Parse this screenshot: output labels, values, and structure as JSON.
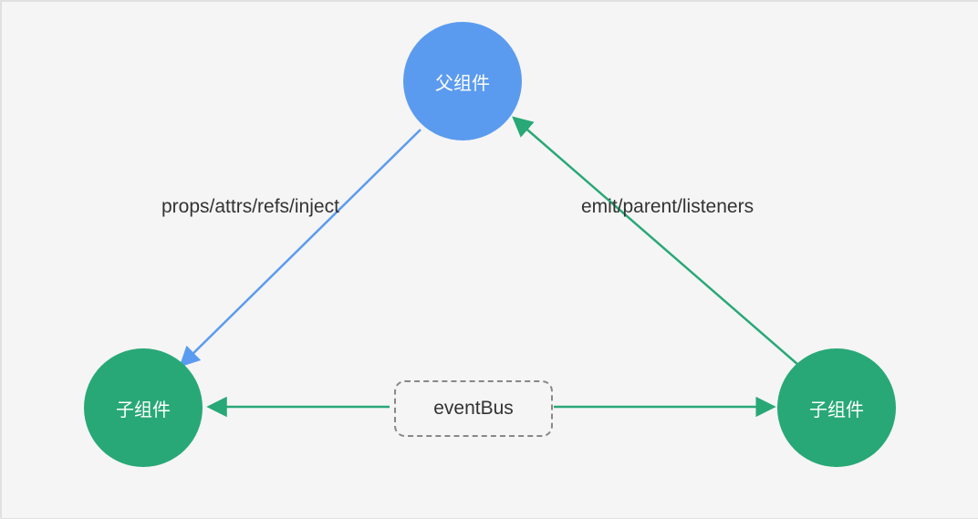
{
  "nodes": {
    "parent": {
      "label": "父组件",
      "color": "#5b9bef"
    },
    "child_left": {
      "label": "子组件",
      "color": "#28a877"
    },
    "child_right": {
      "label": "子组件",
      "color": "#28a877"
    },
    "eventbus": {
      "label": "eventBus"
    }
  },
  "edges": {
    "parent_to_child": {
      "label": "props/attrs/refs/inject",
      "color": "#5b9bef"
    },
    "child_to_parent": {
      "label": "emit/parent/listeners",
      "color": "#28a877"
    },
    "siblings": {
      "via": "eventBus",
      "color": "#28a877"
    }
  }
}
